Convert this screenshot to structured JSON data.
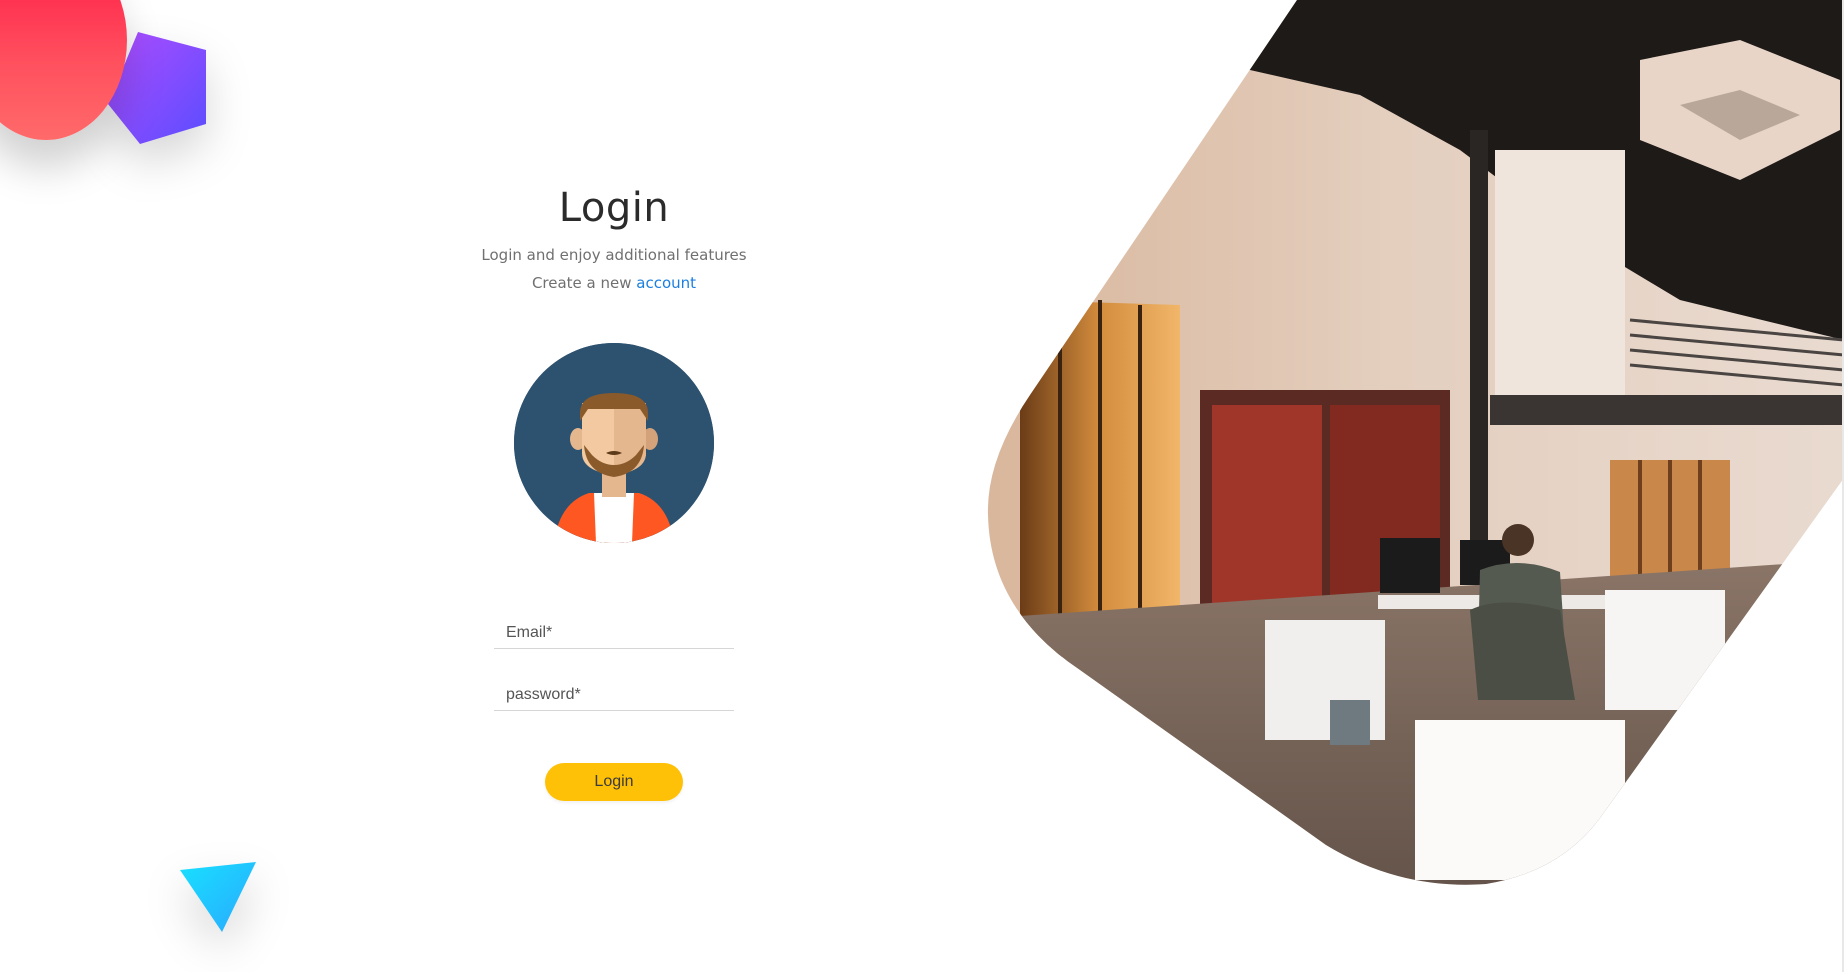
{
  "login": {
    "title": "Login",
    "subtitle": "Login and enjoy additional features",
    "create_prefix": "Create a new ",
    "create_link": "account",
    "email_placeholder": "Email*",
    "password_placeholder": "password*",
    "button_label": "Login"
  },
  "icons": {
    "avatar": "user-avatar-icon",
    "circle": "red-circle-shape",
    "pentagon": "purple-pentagon-shape",
    "triangle": "cyan-triangle-shape"
  },
  "colors": {
    "accent_button": "#ffc107",
    "link": "#1a7fe0",
    "avatar_bg": "#2d5270",
    "circle": "#ff1744",
    "pentagon": "#7c4dff",
    "triangle": "#26c6f5"
  }
}
